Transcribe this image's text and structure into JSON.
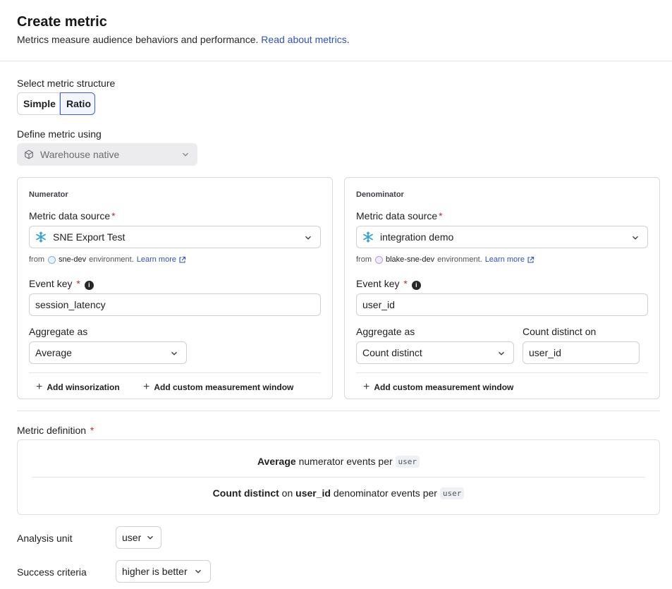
{
  "header": {
    "title": "Create metric",
    "subtitle": "Metrics measure audience behaviors and performance.",
    "link": "Read about metrics",
    "link_suffix": "."
  },
  "structure": {
    "label": "Select metric structure",
    "options": [
      "Simple",
      "Ratio"
    ],
    "selected": "Ratio"
  },
  "define": {
    "label": "Define metric using",
    "value": "Warehouse native"
  },
  "numerator": {
    "title": "Numerator",
    "source_label": "Metric data source",
    "source_value": "SNE Export Test",
    "from_prefix": "from",
    "env_name": "sne-dev",
    "env_suffix": "environment.",
    "learn_more": "Learn more",
    "event_key_label": "Event key",
    "event_key_value": "session_latency",
    "aggregate_label": "Aggregate as",
    "aggregate_value": "Average",
    "actions": [
      "Add winsorization",
      "Add custom measurement window"
    ]
  },
  "denominator": {
    "title": "Denominator",
    "source_label": "Metric data source",
    "source_value": "integration demo",
    "from_prefix": "from",
    "env_name": "blake-sne-dev",
    "env_suffix": "environment.",
    "learn_more": "Learn more",
    "event_key_label": "Event key",
    "event_key_value": "user_id",
    "aggregate_label": "Aggregate as",
    "aggregate_value": "Count distinct",
    "count_distinct_label": "Count distinct on",
    "count_distinct_value": "user_id",
    "actions": [
      "Add custom measurement window"
    ]
  },
  "definition": {
    "label": "Metric definition",
    "line1": {
      "bold": "Average",
      "text": "numerator events per",
      "chip": "user"
    },
    "line2": {
      "bold1": "Count distinct",
      "on": "on",
      "bold2": "user_id",
      "text": "denominator events per",
      "chip": "user"
    }
  },
  "analysis_unit": {
    "label": "Analysis unit",
    "value": "user"
  },
  "success_criteria": {
    "label": "Success criteria",
    "value": "higher is better"
  },
  "colors": {
    "accent": "#3d5fd1",
    "link": "#2e4fc7",
    "required": "#c62828"
  },
  "icons": [
    "snowflake-icon",
    "cube-icon",
    "chevron-down-icon",
    "info-icon",
    "external-link-icon",
    "plus-icon"
  ]
}
